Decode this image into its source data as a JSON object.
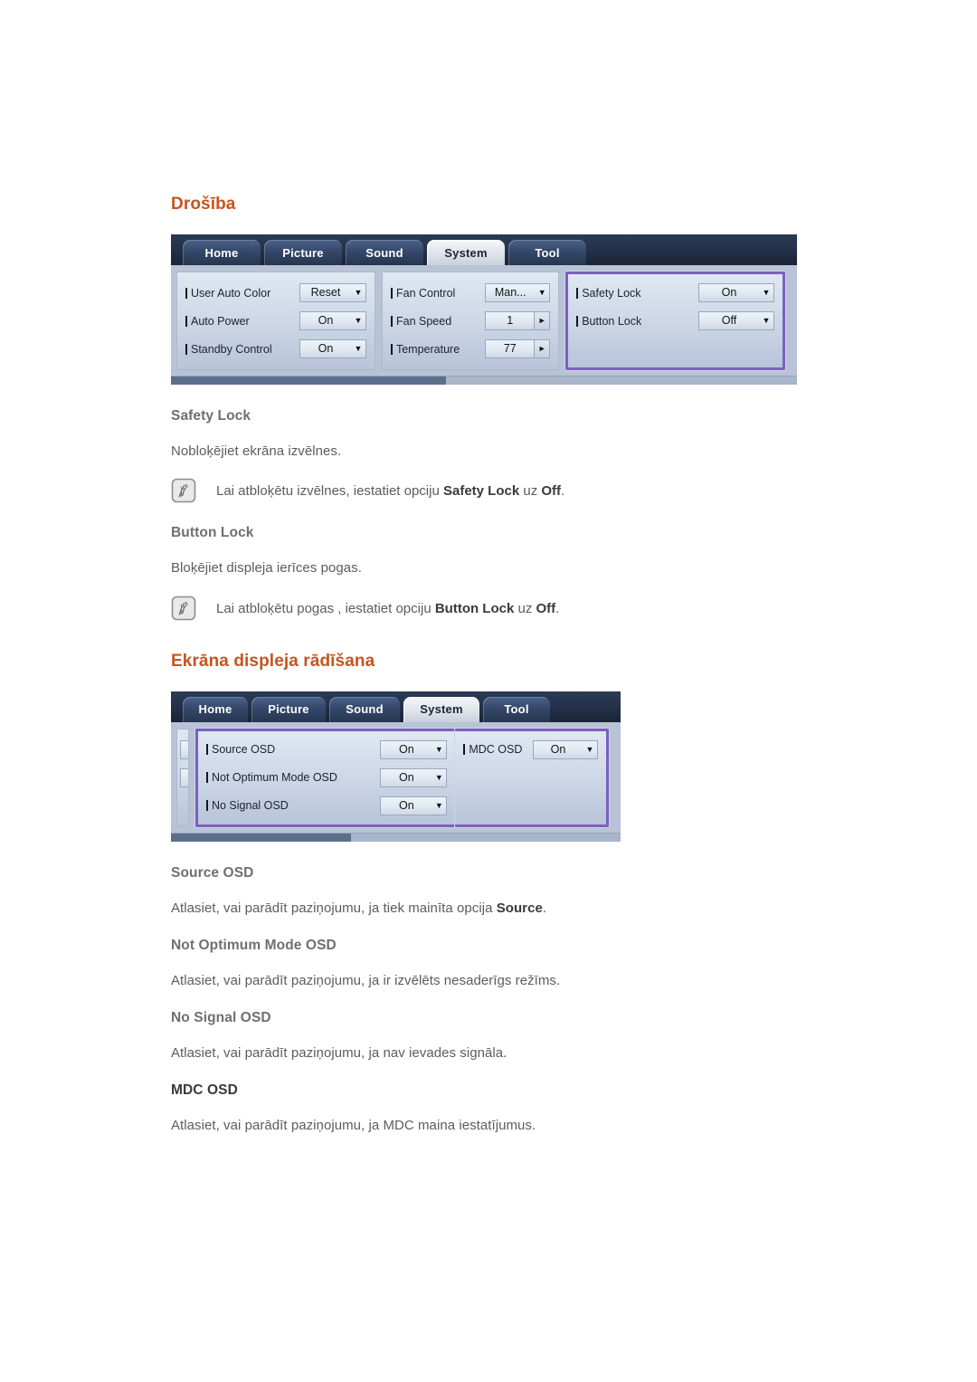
{
  "page": {
    "sections": [
      {
        "id": "drosiba",
        "title": "Drošība"
      },
      {
        "id": "ekrana-displeja-radisana",
        "title": "Ekrāna displeja rādīšana"
      }
    ]
  },
  "osd_system": {
    "tabs": [
      {
        "label": "Home",
        "active": false
      },
      {
        "label": "Picture",
        "active": false
      },
      {
        "label": "Sound",
        "active": false
      },
      {
        "label": "System",
        "active": true
      },
      {
        "label": "Tool",
        "active": false
      }
    ],
    "columns": [
      {
        "highlight": false,
        "rows": [
          {
            "label": "User Auto Color",
            "value": "Reset",
            "control": "dropdown"
          },
          {
            "label": "Auto Power",
            "value": "On",
            "control": "dropdown"
          },
          {
            "label": "Standby Control",
            "value": "On",
            "control": "dropdown"
          }
        ]
      },
      {
        "highlight": false,
        "rows": [
          {
            "label": "Fan Control",
            "value": "Man...",
            "control": "dropdown"
          },
          {
            "label": "Fan Speed",
            "value": "1",
            "control": "spinner"
          },
          {
            "label": "Temperature",
            "value": "77",
            "control": "spinner"
          }
        ]
      },
      {
        "highlight": true,
        "rows": [
          {
            "label": "Safety Lock",
            "value": "On",
            "control": "dropdown"
          },
          {
            "label": "Button Lock",
            "value": "Off",
            "control": "dropdown"
          }
        ]
      }
    ],
    "scroll_thumb_percent": 44,
    "highlight_color": "#7a5fc3"
  },
  "osd_display": {
    "tabs": [
      {
        "label": "Home",
        "active": false
      },
      {
        "label": "Picture",
        "active": false
      },
      {
        "label": "Sound",
        "active": false
      },
      {
        "label": "System",
        "active": true
      },
      {
        "label": "Tool",
        "active": false
      }
    ],
    "columns": [
      {
        "highlight": true,
        "rows": [
          {
            "label": "Source OSD",
            "value": "On",
            "control": "dropdown"
          },
          {
            "label": "Not Optimum Mode OSD",
            "value": "On",
            "control": "dropdown"
          },
          {
            "label": "No Signal OSD",
            "value": "On",
            "control": "dropdown"
          }
        ]
      },
      {
        "highlight": true,
        "rows": [
          {
            "label": "MDC OSD",
            "value": "On",
            "control": "dropdown"
          }
        ]
      }
    ],
    "scroll_thumb_percent": 40,
    "highlight_color": "#7a5fc3"
  },
  "topics": {
    "safety_lock": {
      "title": "Safety Lock",
      "body": "Nobloķējiet ekrāna izvēlnes.",
      "note_prefix": "Lai atbloķētu izvēlnes, iestatiet opciju ",
      "note_bold1": "Safety Lock",
      "note_middle": " uz ",
      "note_bold2": "Off",
      "note_suffix": "."
    },
    "button_lock": {
      "title": "Button Lock",
      "body": "Bloķējiet displeja ierīces pogas.",
      "note_prefix": "Lai atbloķētu pogas , iestatiet opciju ",
      "note_bold1": "Button Lock",
      "note_middle": " uz ",
      "note_bold2": "Off",
      "note_suffix": "."
    },
    "source_osd": {
      "title": "Source OSD",
      "body_prefix": "Atlasiet, vai parādīt paziņojumu, ja tiek mainīta opcija ",
      "body_bold": "Source",
      "body_suffix": "."
    },
    "not_optimum_mode_osd": {
      "title": "Not Optimum Mode OSD",
      "body": "Atlasiet, vai parādīt paziņojumu, ja ir izvēlēts nesaderīgs režīms."
    },
    "no_signal_osd": {
      "title": "No Signal OSD",
      "body": "Atlasiet, vai parādīt paziņojumu, ja nav ievades signāla."
    },
    "mdc_osd": {
      "title": "MDC OSD",
      "body": "Atlasiet, vai parādīt paziņojumu, ja MDC maina iestatījumus."
    }
  },
  "icons": {
    "note": "note-pen-icon",
    "dropdown_caret": "▼",
    "spinner_arrow": "►"
  },
  "colors": {
    "heading": "#c4551f",
    "subheading": "#6f6f72",
    "body": "#5c5c60",
    "osd_highlight": "#7a5fc3",
    "osd_tabbar": "#223049"
  }
}
